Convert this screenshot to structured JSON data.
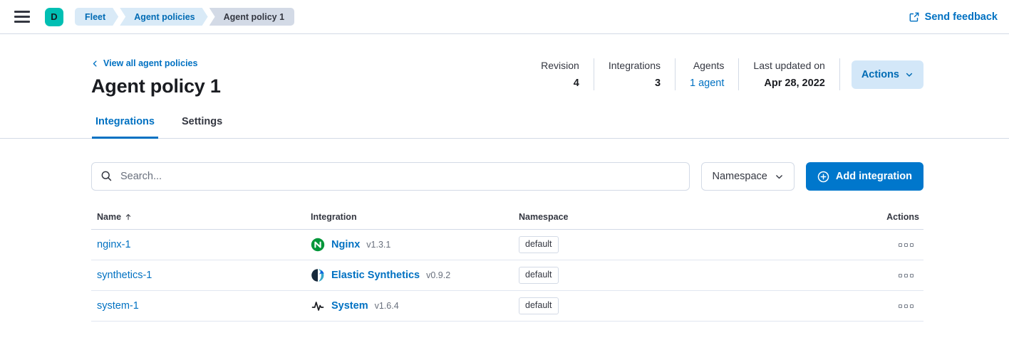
{
  "colors": {
    "primary": "#0071C2",
    "primary_dark": "#006BB4",
    "text": "#343741",
    "title_text": "#1A1C21",
    "subdued": "#69707D",
    "border": "#D3DAE6",
    "avatar_bg": "#00BFB3",
    "breadcrumb_blue_bg": "#D9EAF7",
    "breadcrumb_gray_bg": "#D3DAE6",
    "light_button_bg": "#D3E7F8",
    "filled_button_bg": "#0077CC",
    "nginx_green": "#009639"
  },
  "topbar": {
    "menu_icon": "hamburger-menu-icon",
    "avatar_letter": "D",
    "breadcrumbs": [
      {
        "label": "Fleet"
      },
      {
        "label": "Agent policies"
      },
      {
        "label": "Agent policy 1"
      }
    ],
    "feedback": {
      "icon": "popout-icon",
      "label": "Send feedback"
    }
  },
  "header": {
    "back_link": "View all agent policies",
    "title": "Agent policy 1",
    "stats": [
      {
        "label": "Revision",
        "value": "4"
      },
      {
        "label": "Integrations",
        "value": "3"
      },
      {
        "label": "Agents",
        "value": "1 agent",
        "is_link": true
      },
      {
        "label": "Last updated on",
        "value": "Apr 28, 2022"
      }
    ],
    "actions_button": {
      "label": "Actions",
      "icon": "chevron-down-icon"
    }
  },
  "tabs": [
    {
      "label": "Integrations",
      "active": true
    },
    {
      "label": "Settings",
      "active": false
    }
  ],
  "toolbar": {
    "search": {
      "icon": "search-icon",
      "placeholder": "Search...",
      "value": ""
    },
    "namespace_filter": {
      "label": "Namespace",
      "icon": "chevron-down-icon"
    },
    "add_button": {
      "icon": "plus-circle-icon",
      "label": "Add integration"
    }
  },
  "table": {
    "headers": {
      "name": "Name",
      "name_sort_icon": "sort-up-icon",
      "integration": "Integration",
      "namespace": "Namespace",
      "actions": "Actions"
    },
    "row_actions_icon": "boxes-horizontal-icon",
    "rows": [
      {
        "name": "nginx-1",
        "icon": "nginx-logo-icon",
        "integration": "Nginx",
        "version": "v1.3.1",
        "namespace": "default"
      },
      {
        "name": "synthetics-1",
        "icon": "elastic-synthetics-logo-icon",
        "integration": "Elastic Synthetics",
        "version": "v0.9.2",
        "namespace": "default"
      },
      {
        "name": "system-1",
        "icon": "system-logo-icon",
        "integration": "System",
        "version": "v1.6.4",
        "namespace": "default"
      }
    ]
  }
}
